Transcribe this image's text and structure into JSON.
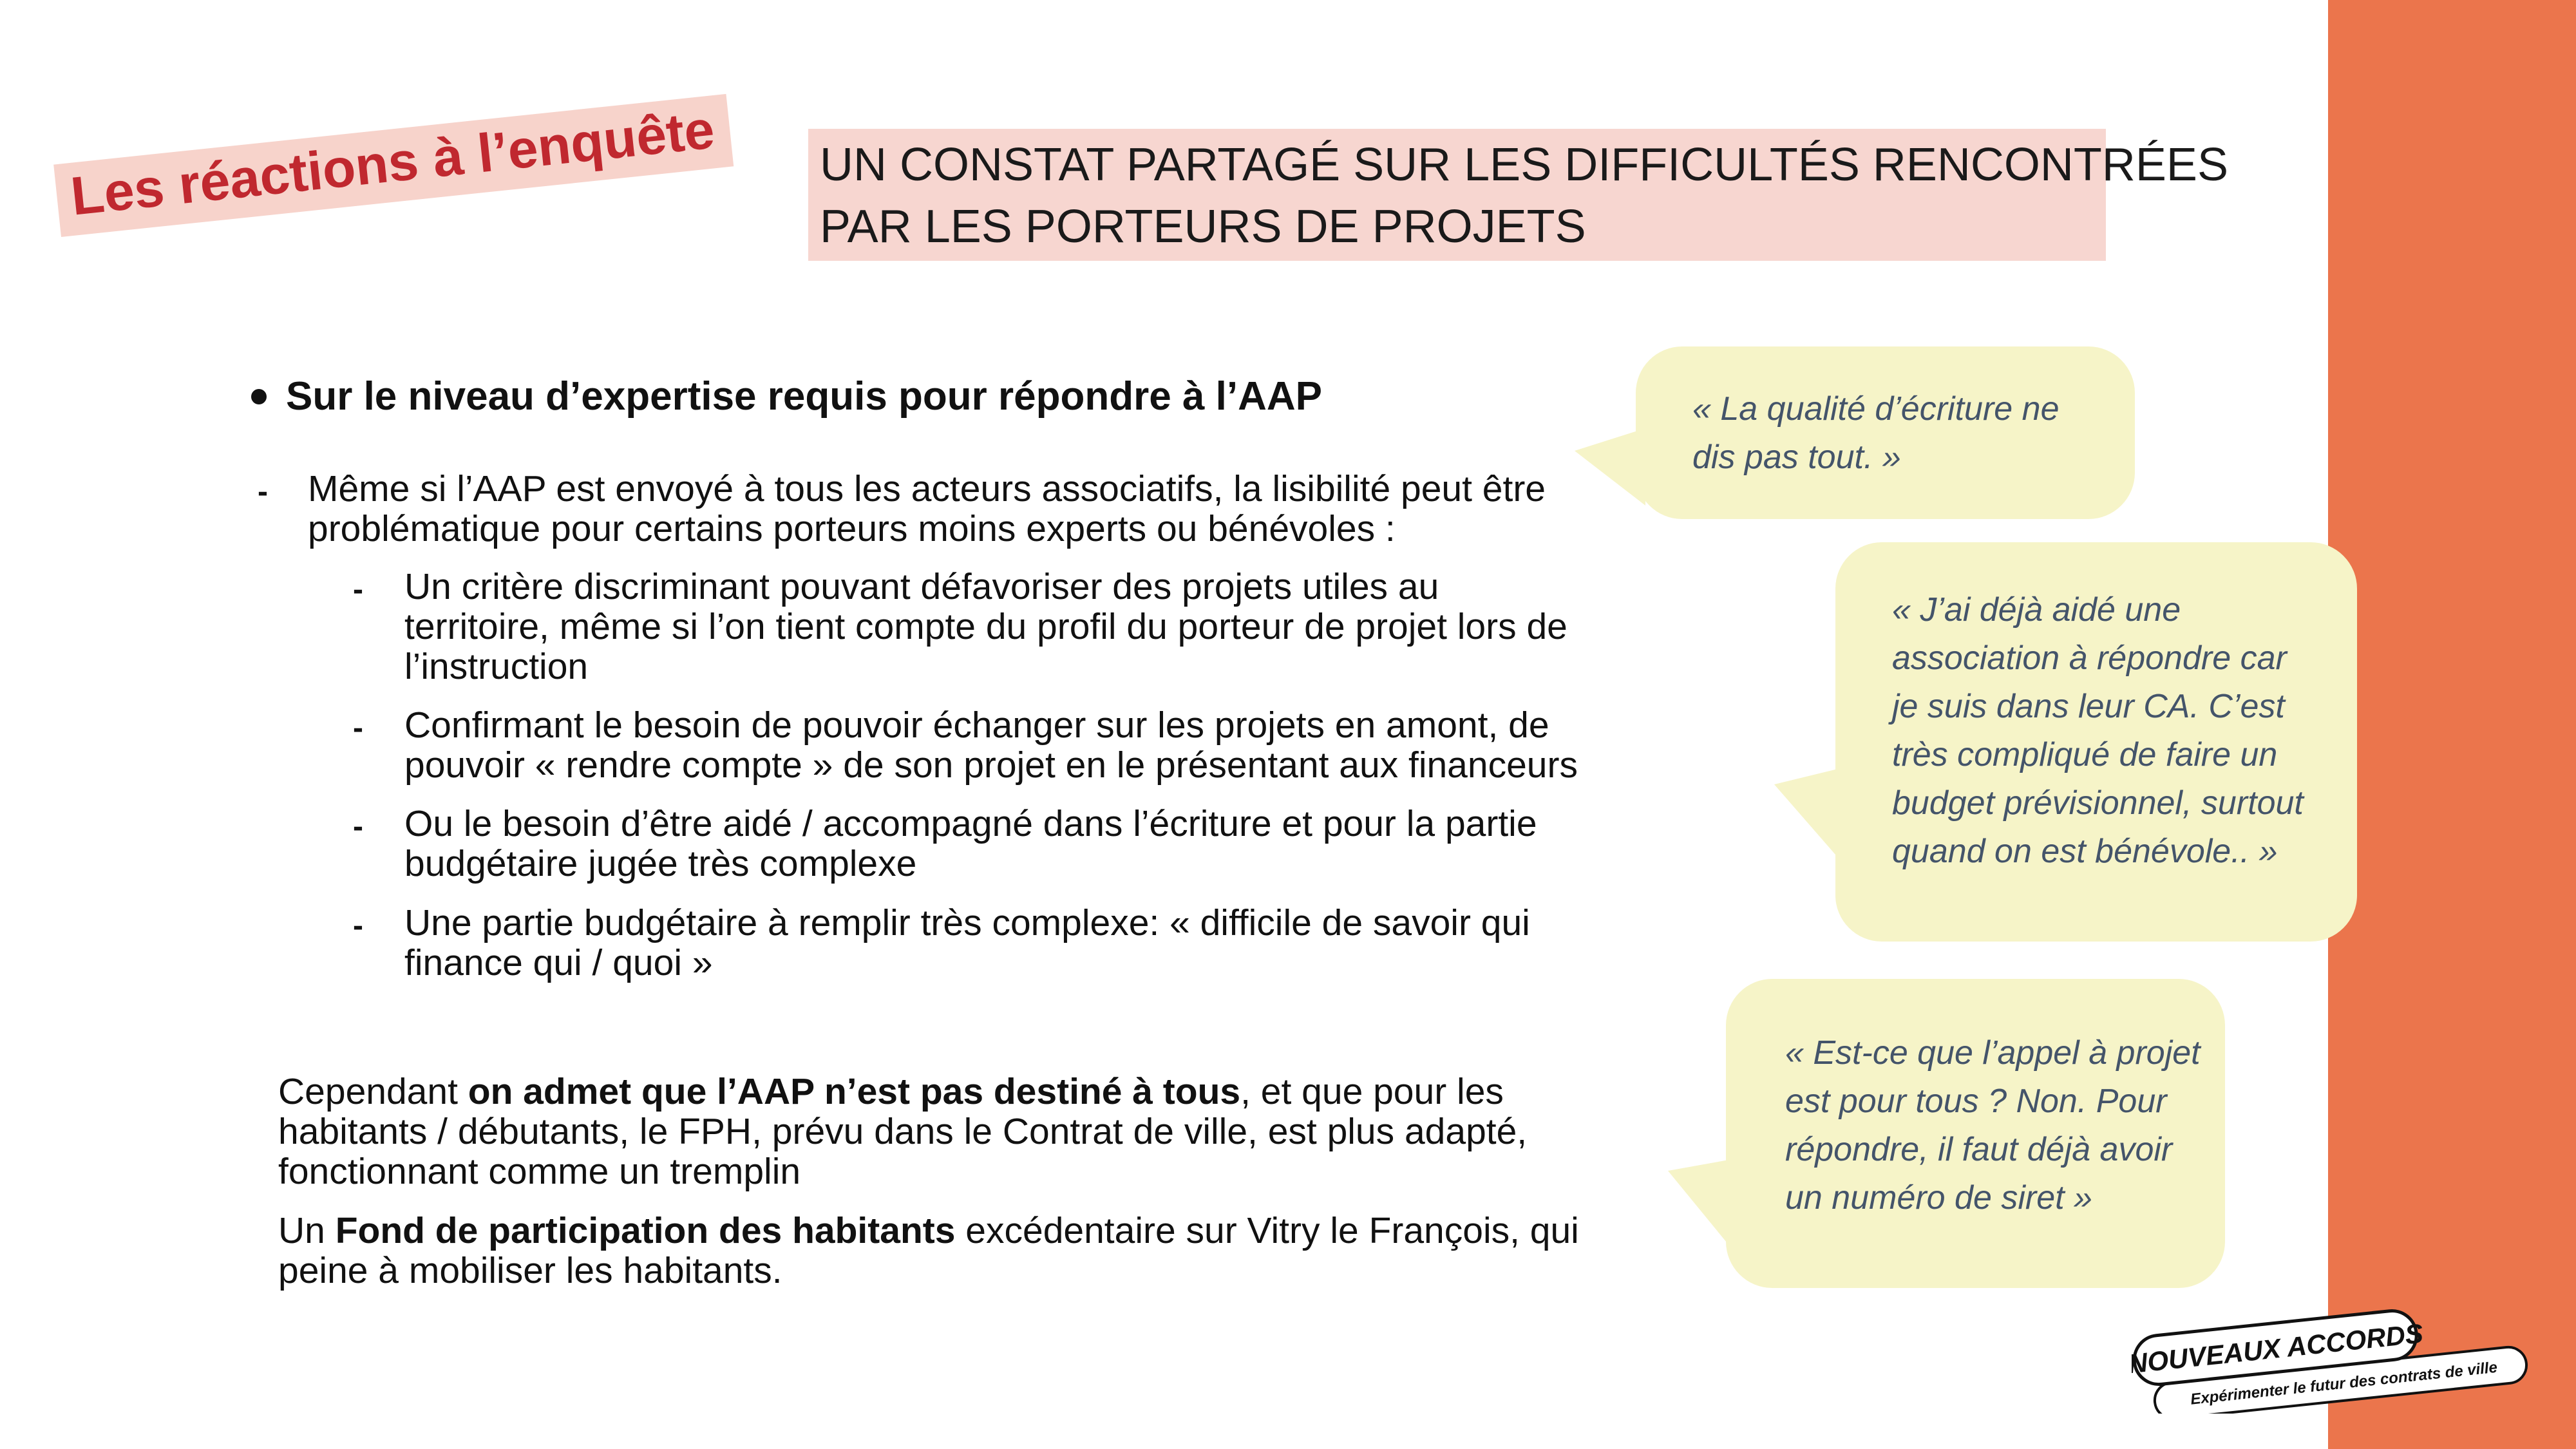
{
  "section_tag": "Les réactions à l’enquête",
  "header": {
    "lines": [
      "UN CONSTAT PARTAGÉ SUR LES DIFFICULTÉS RENCONTRÉES",
      "PAR LES PORTEURS DE PROJETS"
    ]
  },
  "heading": "Sur le niveau d’expertise requis pour répondre à l’AAP",
  "main_point": {
    "lines": [
      "Même si l’AAP est envoyé à tous les acteurs associatifs, la lisibilité peut être",
      "problématique pour certains porteurs moins experts ou bénévoles :"
    ]
  },
  "sub_points": [
    {
      "lines": [
        "Un critère discriminant pouvant défavoriser des projets utiles au",
        "territoire, même si l’on tient compte du profil du porteur de projet lors de",
        "l’instruction"
      ]
    },
    {
      "lines": [
        "Confirmant le besoin de pouvoir échanger sur les projets en amont, de",
        "pouvoir « rendre compte » de son projet en le présentant aux financeurs"
      ]
    },
    {
      "lines": [
        "Ou le besoin d’être aidé / accompagné dans l’écriture et pour la partie",
        "budgétaire jugée très complexe"
      ]
    },
    {
      "lines": [
        "Une partie budgétaire à remplir très complexe: « difficile de savoir qui",
        "finance qui / quoi »"
      ]
    }
  ],
  "however": {
    "prefix": "Cependant ",
    "bold": "on admet que l’AAP n’est pas destiné à tous",
    "suffix": ", et que pour les",
    "lines": [
      "habitants / débutants, le FPH, prévu dans le Contrat de ville, est plus adapté,",
      "fonctionnant comme un tremplin"
    ]
  },
  "fund": {
    "prefix": "Un ",
    "bold": "Fond de participation des habitants",
    "suffix": " excédentaire sur Vitry le François, qui",
    "lines": [
      "peine à mobiliser les habitants."
    ]
  },
  "quotes": [
    {
      "lines": [
        "« La qualité d’écriture ne",
        "dis pas tout. »"
      ]
    },
    {
      "lines": [
        "« J’ai déjà aidé une",
        "association à répondre car",
        "je suis dans leur CA. C’est",
        "très compliqué de faire un",
        "budget prévisionnel, surtout",
        "quand on est bénévole.. »"
      ]
    },
    {
      "lines": [
        "« Est-ce que l’appel à projet",
        "est pour tous ? Non. Pour",
        "répondre, il faut déjà avoir",
        "un numéro de siret »"
      ]
    }
  ],
  "logo": {
    "name": "NOUVEAUX ACCORDS",
    "tagline": "Expérimenter le futur des contrats de ville"
  },
  "colors": {
    "accent_orange": "#EB754C",
    "tag_text": "#C0282F",
    "tag_bg": "#F7D3CB",
    "header_bg": "#F7D6D0",
    "bubble_bg": "#F6F4C8",
    "quote_text": "#44546A"
  }
}
